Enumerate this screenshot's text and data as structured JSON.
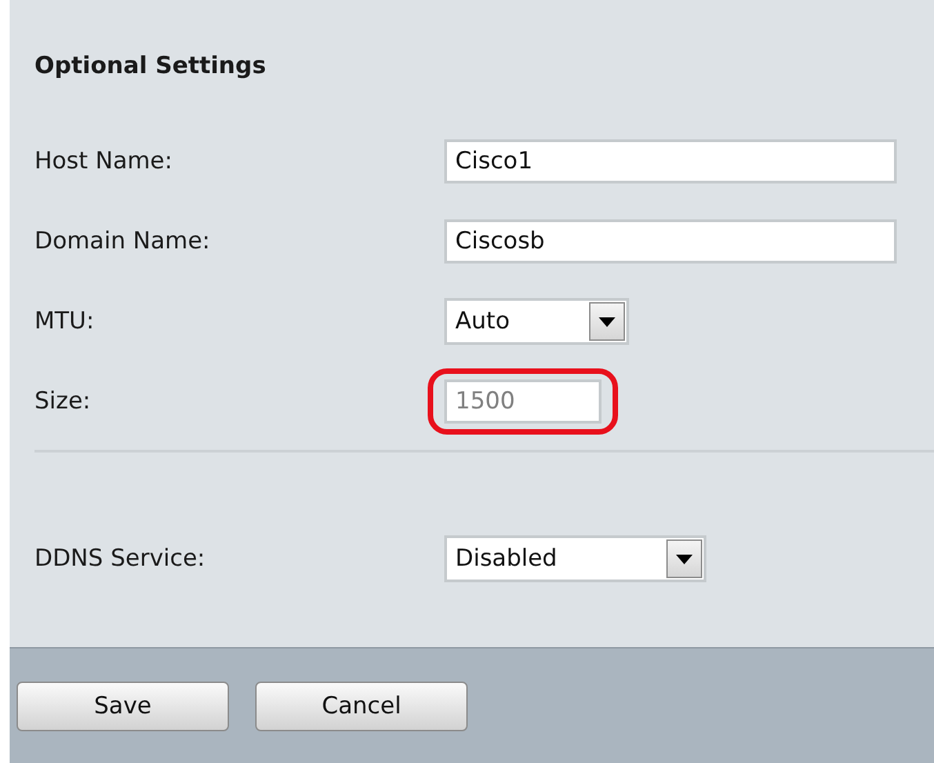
{
  "section": {
    "title": "Optional Settings"
  },
  "fields": [
    {
      "kind": "text",
      "label": "Host Name:",
      "value": "Cisco1",
      "disabled": false,
      "highlighted": false
    },
    {
      "kind": "text",
      "label": "Domain Name:",
      "value": "Ciscosb",
      "disabled": false,
      "highlighted": false
    },
    {
      "kind": "select",
      "label": "MTU:",
      "value": "Auto",
      "disabled": false,
      "highlighted": false
    },
    {
      "kind": "short",
      "label": "Size:",
      "value": "1500",
      "disabled": true,
      "highlighted": true
    }
  ],
  "ddns": {
    "kind": "select",
    "label": "DDNS Service:",
    "value": "Disabled",
    "disabled": false,
    "highlighted": false
  },
  "buttons": [
    "Save",
    "Cancel"
  ]
}
